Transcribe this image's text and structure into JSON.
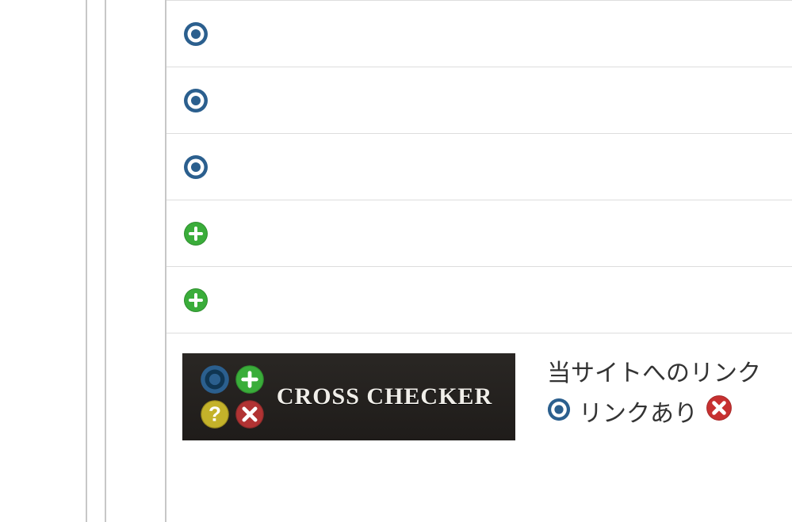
{
  "list": {
    "rows": [
      {
        "icon": "circle"
      },
      {
        "icon": "circle"
      },
      {
        "icon": "circle"
      },
      {
        "icon": "plus"
      },
      {
        "icon": "plus"
      }
    ]
  },
  "banner": {
    "title": "CROSS CHECKER"
  },
  "legend": {
    "header": "当サイトへのリンク",
    "link_ok": "リンクあり"
  }
}
